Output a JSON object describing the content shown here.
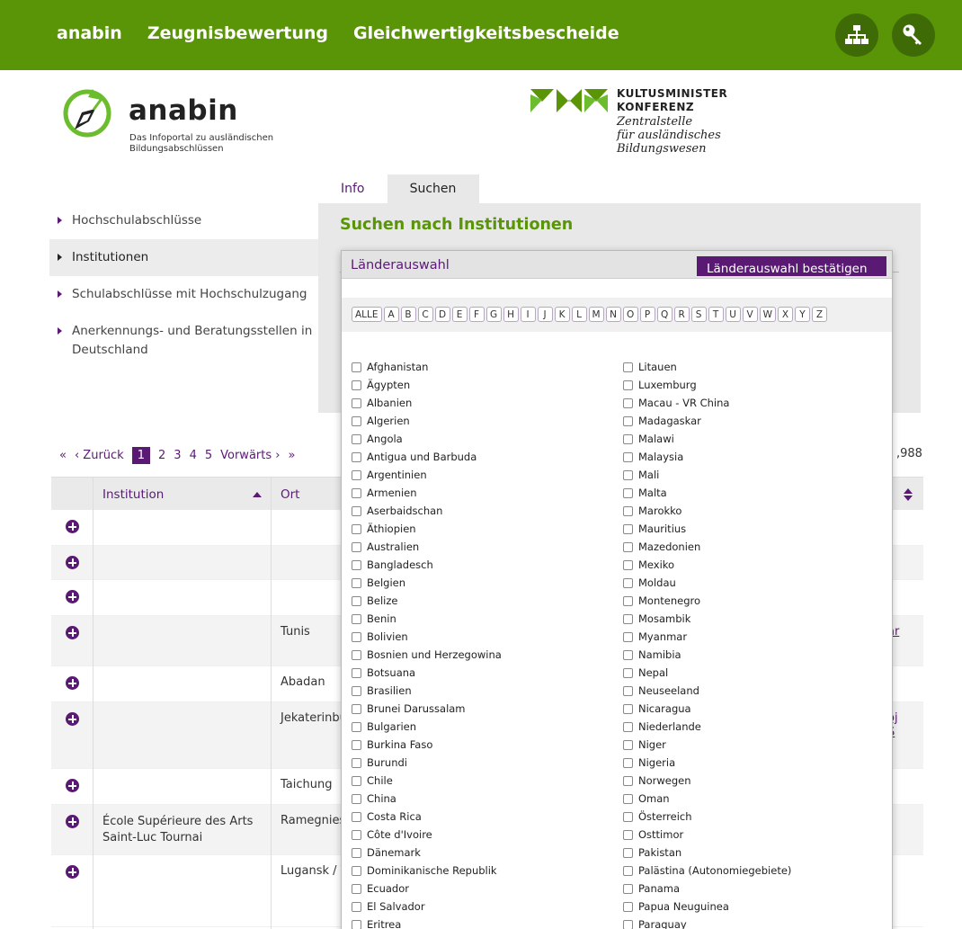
{
  "topnav": {
    "items": [
      "anabin",
      "Zeugnisbewertung",
      "Gleichwertigkeitsbescheide"
    ]
  },
  "icons": {
    "sitemap": "sitemap-icon",
    "login": "key-icon"
  },
  "colors": {
    "brand_green": "#5a9508",
    "accent_purple": "#5a1a74"
  },
  "logo": {
    "name": "anabin",
    "tagline_1": "Das Infoportal zu ausländischen",
    "tagline_2": "Bildungsabschlüssen",
    "kmk_line1": "KULTUSMINISTER",
    "kmk_line2": "KONFERENZ",
    "kmk_sub1": "Zentralstelle",
    "kmk_sub2": "für ausländisches",
    "kmk_sub3": "Bildungswesen"
  },
  "tabs": [
    "Info",
    "Suchen"
  ],
  "sidebar": {
    "items": [
      "Hochschulabschlüsse",
      "Institutionen",
      "Schulabschlüsse mit Hochschulzugang",
      "Anerkennungs- und Beratungsstellen in Deutschland"
    ]
  },
  "panel": {
    "title": "Suchen nach Institutionen"
  },
  "pager": {
    "first": "«",
    "prev": "‹ Zurück",
    "pages": [
      "1",
      "2",
      "3",
      "4",
      "5"
    ],
    "next": "Vorwärts ›",
    "last": "»",
    "count_fragment": ",988"
  },
  "table": {
    "headers": {
      "institution": "Institution",
      "ort": "Ort"
    },
    "rows": [
      {
        "institution": "",
        "ort": "",
        "link": ""
      },
      {
        "institution": "",
        "ort": "",
        "link": ""
      },
      {
        "institution": "",
        "ort": "",
        "link": ""
      },
      {
        "institution": "",
        "ort": "Tunis",
        "link": "ar"
      },
      {
        "institution": "",
        "ort": "Abadan",
        "link": ""
      },
      {
        "institution": "",
        "ort": "Jekaterinbu",
        "link": "oj\nS"
      },
      {
        "institution": "",
        "ort": "Taichung",
        "link": ""
      },
      {
        "institution": "École Supérieure des Arts\nSaint-Luc Tournai",
        "ort": "Ramegnies",
        "link": ""
      },
      {
        "institution": "",
        "ort": "Lugansk / V",
        "link": ""
      }
    ]
  },
  "modal": {
    "title": "Länderauswahl",
    "confirm": "Länderauswahl bestätigen",
    "letters": [
      "ALLE",
      "A",
      "B",
      "C",
      "D",
      "E",
      "F",
      "G",
      "H",
      "I",
      "J",
      "K",
      "L",
      "M",
      "N",
      "O",
      "P",
      "Q",
      "R",
      "S",
      "T",
      "U",
      "V",
      "W",
      "X",
      "Y",
      "Z"
    ],
    "countries_left": [
      "Afghanistan",
      "Ägypten",
      "Albanien",
      "Algerien",
      "Angola",
      "Antigua und Barbuda",
      "Argentinien",
      "Armenien",
      "Aserbaidschan",
      "Äthiopien",
      "Australien",
      "Bangladesch",
      "Belgien",
      "Belize",
      "Benin",
      "Bolivien",
      "Bosnien und Herzegowina",
      "Botsuana",
      "Brasilien",
      "Brunei Darussalam",
      "Bulgarien",
      "Burkina Faso",
      "Burundi",
      "Chile",
      "China",
      "Costa Rica",
      "Côte d'Ivoire",
      "Dänemark",
      "Dominikanische Republik",
      "Ecuador",
      "El Salvador",
      "Eritrea"
    ],
    "countries_right": [
      "Litauen",
      "Luxemburg",
      "Macau - VR China",
      "Madagaskar",
      "Malawi",
      "Malaysia",
      "Mali",
      "Malta",
      "Marokko",
      "Mauritius",
      "Mazedonien",
      "Mexiko",
      "Moldau",
      "Montenegro",
      "Mosambik",
      "Myanmar",
      "Namibia",
      "Nepal",
      "Neuseeland",
      "Nicaragua",
      "Niederlande",
      "Niger",
      "Nigeria",
      "Norwegen",
      "Oman",
      "Österreich",
      "Osttimor",
      "Pakistan",
      "Palästina (Autonomiegebiete)",
      "Panama",
      "Papua Neuguinea",
      "Paraguay"
    ]
  }
}
